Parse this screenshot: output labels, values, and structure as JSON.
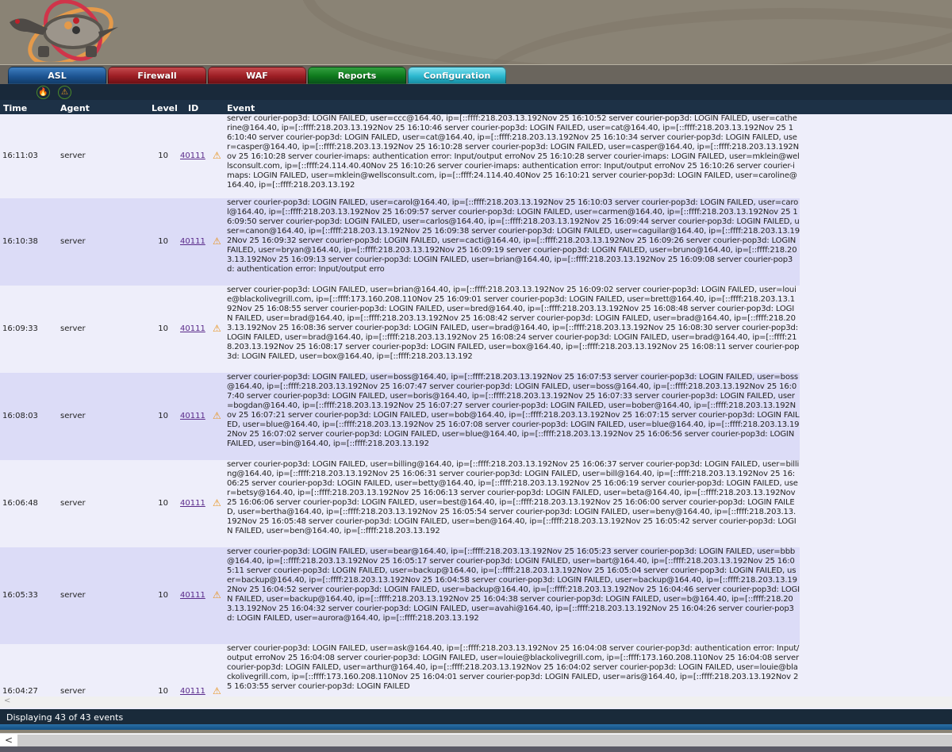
{
  "tabs": [
    {
      "label": "ASL",
      "active": true,
      "color": "#1d5593"
    },
    {
      "label": "Firewall",
      "color": "#9d1e24"
    },
    {
      "label": "WAF",
      "color": "#9d1e24"
    },
    {
      "label": "Reports",
      "color": "#0e7a1c"
    },
    {
      "label": "Configuration",
      "color": "#2cb8cf"
    }
  ],
  "toolbar_icons": [
    "fire-icon",
    "alert-icon"
  ],
  "columns": {
    "time": "Time",
    "agent": "Agent",
    "level": "Level",
    "id": "ID",
    "event": "Event"
  },
  "rows": [
    {
      "time": "16:11:03",
      "agent": "server",
      "level": "10",
      "id": "40111",
      "icon": "warning-icon",
      "event": "server courier-pop3d: LOGIN FAILED, user=ccc@164.40, ip=[::ffff:218.203.13.192Nov 25 16:10:52 server courier-pop3d: LOGIN FAILED, user=catherine@164.40, ip=[::ffff:218.203.13.192Nov 25 16:10:46 server courier-pop3d: LOGIN FAILED, user=cat@164.40, ip=[::ffff:218.203.13.192Nov 25 16:10:40 server courier-pop3d: LOGIN FAILED, user=cat@164.40, ip=[::ffff:218.203.13.192Nov 25 16:10:34 server courier-pop3d: LOGIN FAILED, user=casper@164.40, ip=[::ffff:218.203.13.192Nov 25 16:10:28 server courier-pop3d: LOGIN FAILED, user=casper@164.40, ip=[::ffff:218.203.13.192Nov 25 16:10:28 server courier-imaps: authentication error: Input/output erroNov 25 16:10:28 server courier-imaps: LOGIN FAILED, user=mklein@wellsconsult.com, ip=[::ffff:24.114.40.40Nov 25 16:10:26 server courier-imaps: authentication error: Input/output erroNov 25 16:10:26 server courier-imaps: LOGIN FAILED, user=mklein@wellsconsult.com, ip=[::ffff:24.114.40.40Nov 25 16:10:21 server courier-pop3d: LOGIN FAILED, user=caroline@164.40, ip=[::ffff:218.203.13.192"
    },
    {
      "time": "16:10:38",
      "agent": "server",
      "level": "10",
      "id": "40111",
      "icon": "warning-icon",
      "event": "server courier-pop3d: LOGIN FAILED, user=carol@164.40, ip=[::ffff:218.203.13.192Nov 25 16:10:03 server courier-pop3d: LOGIN FAILED, user=carol@164.40, ip=[::ffff:218.203.13.192Nov 25 16:09:57 server courier-pop3d: LOGIN FAILED, user=carmen@164.40, ip=[::ffff:218.203.13.192Nov 25 16:09:50 server courier-pop3d: LOGIN FAILED, user=carlos@164.40, ip=[::ffff:218.203.13.192Nov 25 16:09:44 server courier-pop3d: LOGIN FAILED, user=canon@164.40, ip=[::ffff:218.203.13.192Nov 25 16:09:38 server courier-pop3d: LOGIN FAILED, user=caguilar@164.40, ip=[::ffff:218.203.13.192Nov 25 16:09:32 server courier-pop3d: LOGIN FAILED, user=cacti@164.40, ip=[::ffff:218.203.13.192Nov 25 16:09:26 server courier-pop3d: LOGIN FAILED, user=bryan@164.40, ip=[::ffff:218.203.13.192Nov 25 16:09:19 server courier-pop3d: LOGIN FAILED, user=bruno@164.40, ip=[::ffff:218.203.13.192Nov 25 16:09:13 server courier-pop3d: LOGIN FAILED, user=brian@164.40, ip=[::ffff:218.203.13.192Nov 25 16:09:08 server courier-pop3d: authentication error: Input/output erro"
    },
    {
      "time": "16:09:33",
      "agent": "server",
      "level": "10",
      "id": "40111",
      "icon": "warning-icon",
      "event": "server courier-pop3d: LOGIN FAILED, user=brian@164.40, ip=[::ffff:218.203.13.192Nov 25 16:09:02 server courier-pop3d: LOGIN FAILED, user=louie@blackolivegrill.com, ip=[::ffff:173.160.208.110Nov 25 16:09:01 server courier-pop3d: LOGIN FAILED, user=brett@164.40, ip=[::ffff:218.203.13.192Nov 25 16:08:55 server courier-pop3d: LOGIN FAILED, user=bred@164.40, ip=[::ffff:218.203.13.192Nov 25 16:08:48 server courier-pop3d: LOGIN FAILED, user=brad@164.40, ip=[::ffff:218.203.13.192Nov 25 16:08:42 server courier-pop3d: LOGIN FAILED, user=brad@164.40, ip=[::ffff:218.203.13.192Nov 25 16:08:36 server courier-pop3d: LOGIN FAILED, user=brad@164.40, ip=[::ffff:218.203.13.192Nov 25 16:08:30 server courier-pop3d: LOGIN FAILED, user=brad@164.40, ip=[::ffff:218.203.13.192Nov 25 16:08:24 server courier-pop3d: LOGIN FAILED, user=brad@164.40, ip=[::ffff:218.203.13.192Nov 25 16:08:17 server courier-pop3d: LOGIN FAILED, user=box@164.40, ip=[::ffff:218.203.13.192Nov 25 16:08:11 server courier-pop3d: LOGIN FAILED, user=box@164.40, ip=[::ffff:218.203.13.192"
    },
    {
      "time": "16:08:03",
      "agent": "server",
      "level": "10",
      "id": "40111",
      "icon": "warning-icon",
      "event": "server courier-pop3d: LOGIN FAILED, user=boss@164.40, ip=[::ffff:218.203.13.192Nov 25 16:07:53 server courier-pop3d: LOGIN FAILED, user=boss@164.40, ip=[::ffff:218.203.13.192Nov 25 16:07:47 server courier-pop3d: LOGIN FAILED, user=boss@164.40, ip=[::ffff:218.203.13.192Nov 25 16:07:40 server courier-pop3d: LOGIN FAILED, user=boris@164.40, ip=[::ffff:218.203.13.192Nov 25 16:07:33 server courier-pop3d: LOGIN FAILED, user=bogdan@164.40, ip=[::ffff:218.203.13.192Nov 25 16:07:27 server courier-pop3d: LOGIN FAILED, user=bober@164.40, ip=[::ffff:218.203.13.192Nov 25 16:07:21 server courier-pop3d: LOGIN FAILED, user=bob@164.40, ip=[::ffff:218.203.13.192Nov 25 16:07:15 server courier-pop3d: LOGIN FAILED, user=blue@164.40, ip=[::ffff:218.203.13.192Nov 25 16:07:08 server courier-pop3d: LOGIN FAILED, user=blue@164.40, ip=[::ffff:218.203.13.192Nov 25 16:07:02 server courier-pop3d: LOGIN FAILED, user=blue@164.40, ip=[::ffff:218.203.13.192Nov 25 16:06:56 server courier-pop3d: LOGIN FAILED, user=bin@164.40, ip=[::ffff:218.203.13.192"
    },
    {
      "time": "16:06:48",
      "agent": "server",
      "level": "10",
      "id": "40111",
      "icon": "warning-icon",
      "event": "server courier-pop3d: LOGIN FAILED, user=billing@164.40, ip=[::ffff:218.203.13.192Nov 25 16:06:37 server courier-pop3d: LOGIN FAILED, user=billing@164.40, ip=[::ffff:218.203.13.192Nov 25 16:06:31 server courier-pop3d: LOGIN FAILED, user=bill@164.40, ip=[::ffff:218.203.13.192Nov 25 16:06:25 server courier-pop3d: LOGIN FAILED, user=betty@164.40, ip=[::ffff:218.203.13.192Nov 25 16:06:19 server courier-pop3d: LOGIN FAILED, user=betsy@164.40, ip=[::ffff:218.203.13.192Nov 25 16:06:13 server courier-pop3d: LOGIN FAILED, user=beta@164.40, ip=[::ffff:218.203.13.192Nov 25 16:06:06 server courier-pop3d: LOGIN FAILED, user=best@164.40, ip=[::ffff:218.203.13.192Nov 25 16:06:00 server courier-pop3d: LOGIN FAILED, user=bertha@164.40, ip=[::ffff:218.203.13.192Nov 25 16:05:54 server courier-pop3d: LOGIN FAILED, user=beny@164.40, ip=[::ffff:218.203.13.192Nov 25 16:05:48 server courier-pop3d: LOGIN FAILED, user=ben@164.40, ip=[::ffff:218.203.13.192Nov 25 16:05:42 server courier-pop3d: LOGIN FAILED, user=ben@164.40, ip=[::ffff:218.203.13.192"
    },
    {
      "time": "16:05:33",
      "agent": "server",
      "level": "10",
      "id": "40111",
      "icon": "warning-icon",
      "event": "server courier-pop3d: LOGIN FAILED, user=bear@164.40, ip=[::ffff:218.203.13.192Nov 25 16:05:23 server courier-pop3d: LOGIN FAILED, user=bbb@164.40, ip=[::ffff:218.203.13.192Nov 25 16:05:17 server courier-pop3d: LOGIN FAILED, user=bart@164.40, ip=[::ffff:218.203.13.192Nov 25 16:05:11 server courier-pop3d: LOGIN FAILED, user=backup@164.40, ip=[::ffff:218.203.13.192Nov 25 16:05:04 server courier-pop3d: LOGIN FAILED, user=backup@164.40, ip=[::ffff:218.203.13.192Nov 25 16:04:58 server courier-pop3d: LOGIN FAILED, user=backup@164.40, ip=[::ffff:218.203.13.192Nov 25 16:04:52 server courier-pop3d: LOGIN FAILED, user=backup@164.40, ip=[::ffff:218.203.13.192Nov 25 16:04:46 server courier-pop3d: LOGIN FAILED, user=backup@164.40, ip=[::ffff:218.203.13.192Nov 25 16:04:38 server courier-pop3d: LOGIN FAILED, user=b@164.40, ip=[::ffff:218.203.13.192Nov 25 16:04:32 server courier-pop3d: LOGIN FAILED, user=avahi@164.40, ip=[::ffff:218.203.13.192Nov 25 16:04:26 server courier-pop3d: LOGIN FAILED, user=aurora@164.40, ip=[::ffff:218.203.13.192"
    },
    {
      "time": "16:04:27",
      "agent": "server",
      "level": "10",
      "id": "40111",
      "icon": "warning-icon",
      "event": "server courier-pop3d: LOGIN FAILED, user=ask@164.40, ip=[::ffff:218.203.13.192Nov 25 16:04:08 server courier-pop3d: authentication error: Input/output erroNov 25 16:04:08 server courier-pop3d: LOGIN FAILED, user=louie@blackolivegrill.com, ip=[::ffff:173.160.208.110Nov 25 16:04:08 server courier-pop3d: LOGIN FAILED, user=arthur@164.40, ip=[::ffff:218.203.13.192Nov 25 16:04:02 server courier-pop3d: LOGIN FAILED, user=louie@blackolivegrill.com, ip=[::ffff:173.160.208.110Nov 25 16:04:01 server courier-pop3d: LOGIN FAILED, user=aris@164.40, ip=[::ffff:218.203.13.192Nov 25 16:03:55 server courier-pop3d: LOGIN FAILED"
    }
  ],
  "status": {
    "text": "Displaying 43 of 43 events"
  },
  "scroll": {
    "left_arrow": "<"
  }
}
